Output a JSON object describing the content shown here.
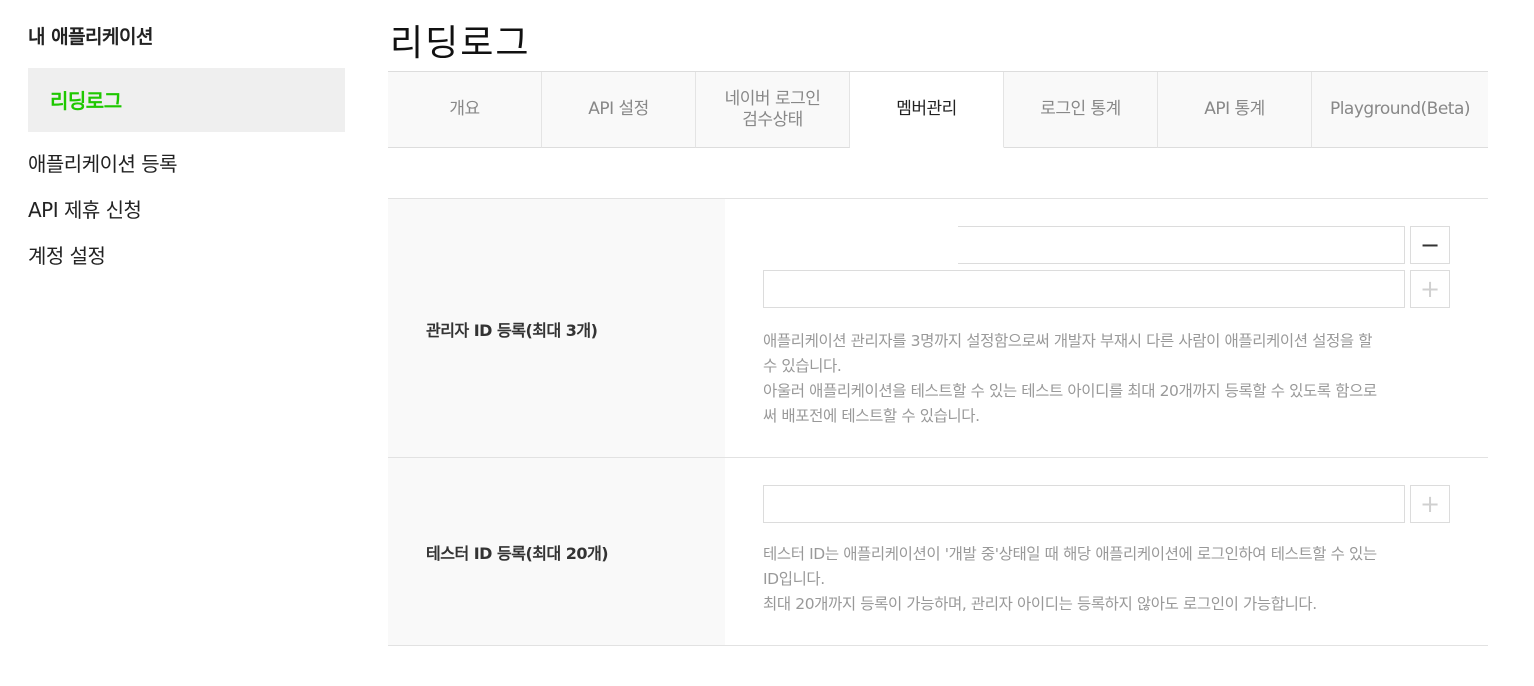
{
  "sidebar": {
    "title": "내 애플리케이션",
    "active_app": "리딩로그",
    "links": [
      "애플리케이션 등록",
      "API 제휴 신청",
      "계정 설정"
    ]
  },
  "page": {
    "title": "리딩로그"
  },
  "tabs": [
    {
      "label": "개요"
    },
    {
      "label": "API 설정"
    },
    {
      "label_line1": "네이버 로그인",
      "label_line2": "검수상태"
    },
    {
      "label": "멤버관리"
    },
    {
      "label": "로그인 통계"
    },
    {
      "label": "API 통계"
    },
    {
      "label": "Playground(Beta)"
    }
  ],
  "admin": {
    "label": "관리자 ID 등록(최대 3개)",
    "input1_value": "",
    "input2_value": "",
    "minus_symbol": "−",
    "plus_symbol": "+",
    "help_line1": "애플리케이션 관리자를 3명까지 설정함으로써 개발자 부재시 다른 사람이 애플리케이션 설정을 할",
    "help_line2": "수 있습니다.",
    "help_line3": "아울러 애플리케이션을 테스트할 수 있는 테스트 아이디를 최대 20개까지 등록할 수 있도록 함으로",
    "help_line4": "써 배포전에 테스트할 수 있습니다."
  },
  "tester": {
    "label": "테스터 ID 등록(최대 20개)",
    "input_value": "",
    "plus_symbol": "+",
    "help_line1": "테스터 ID는 애플리케이션이 '개발 중'상태일 때 해당 애플리케이션에 로그인하여 테스트할 수 있는",
    "help_line2": "ID입니다.",
    "help_line3": "최대 20개까지 등록이 가능하며, 관리자 아이디는 등록하지 않아도 로그인이 가능합니다."
  },
  "colors": {
    "accent_green": "#1ec800",
    "label_bg": "#f9f9f9",
    "help_text": "#999999"
  }
}
